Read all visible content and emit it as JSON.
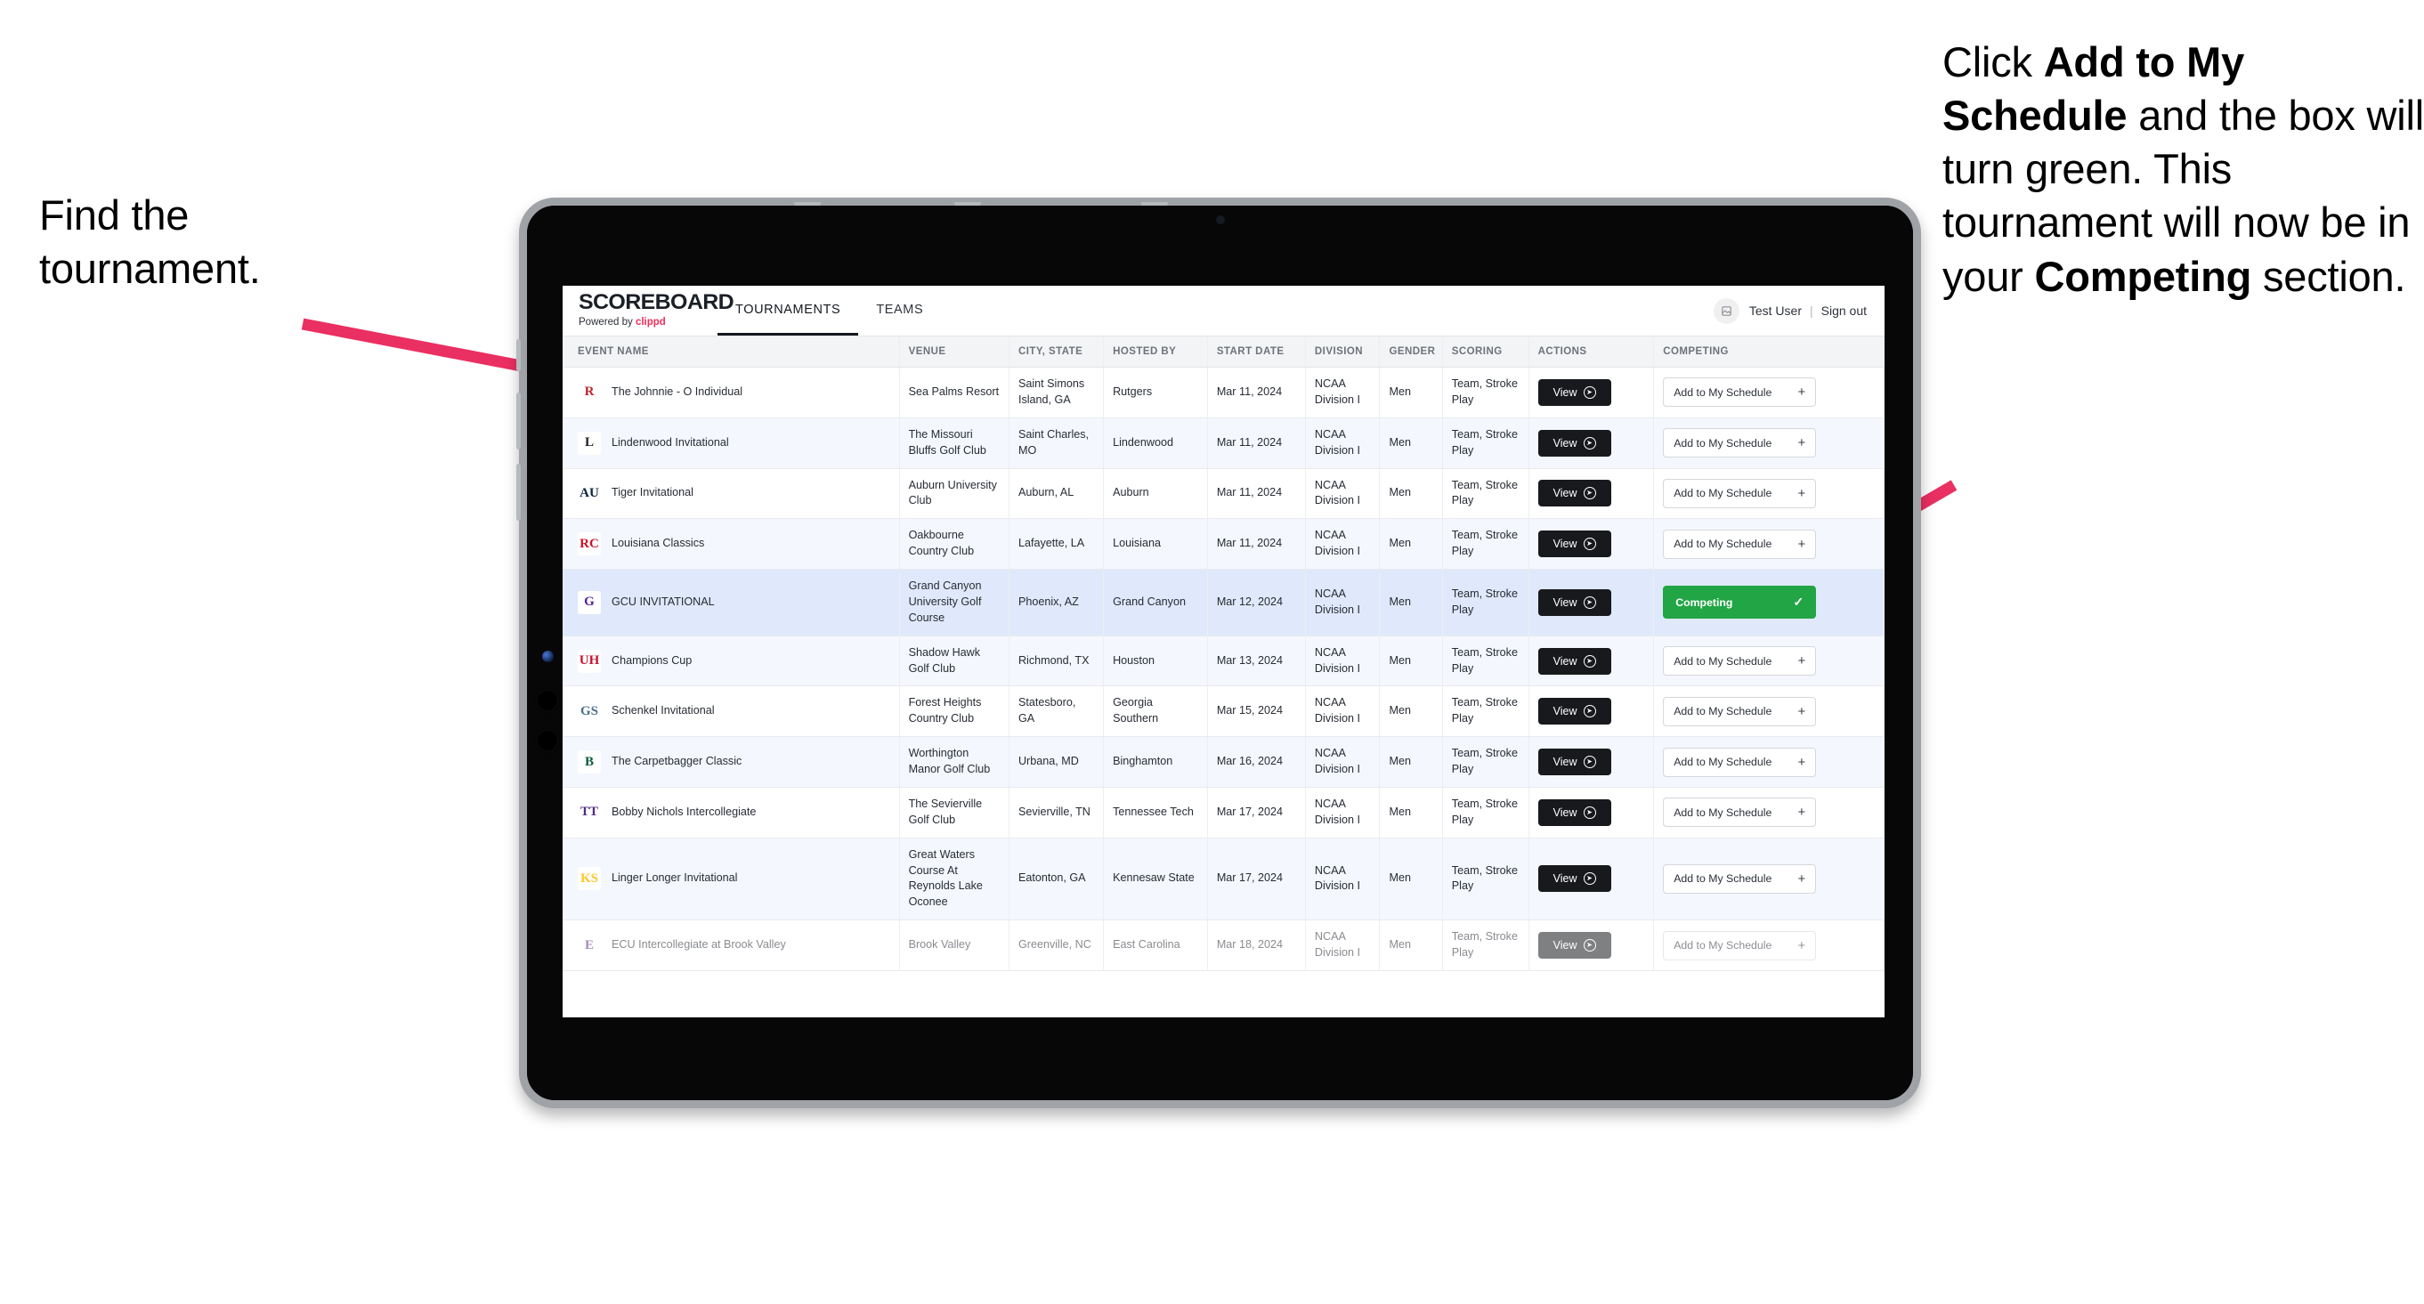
{
  "annotations": {
    "left": "Find the tournament.",
    "right_parts": [
      {
        "t": "Click ",
        "b": false
      },
      {
        "t": "Add to My Schedule",
        "b": true
      },
      {
        "t": " and the box will turn green. This tournament will now be in your ",
        "b": false
      },
      {
        "t": "Competing",
        "b": true
      },
      {
        "t": " section.",
        "b": false
      }
    ],
    "arrow_color": "#ea2f62"
  },
  "app": {
    "brand": {
      "title": "SCOREBOARD",
      "powered_prefix": "Powered by ",
      "powered_brand": "clippd"
    },
    "nav": [
      {
        "label": "TOURNAMENTS",
        "active": true
      },
      {
        "label": "TEAMS",
        "active": false
      }
    ],
    "user": {
      "avatar_icon": "user-avatar-icon",
      "name": "Test User",
      "separator": "|",
      "signout": "Sign out"
    },
    "table": {
      "columns": [
        "EVENT NAME",
        "VENUE",
        "CITY, STATE",
        "HOSTED BY",
        "START DATE",
        "DIVISION",
        "GENDER",
        "SCORING",
        "ACTIONS",
        "COMPETING"
      ],
      "view_label": "View",
      "add_label": "Add to My Schedule",
      "add_icon": "plus-icon",
      "competing_label": "Competing",
      "competing_icon": "check-icon",
      "rows": [
        {
          "logo_text": "R",
          "logo_bg": "#ffffff",
          "logo_fg": "#bb2429",
          "event": "The Johnnie - O Individual",
          "venue": "Sea Palms Resort",
          "city": "Saint Simons Island, GA",
          "hosted": "Rutgers",
          "date": "Mar 11, 2024",
          "division": "NCAA Division I",
          "gender": "Men",
          "scoring": "Team, Stroke Play",
          "competing": false
        },
        {
          "logo_text": "L",
          "logo_bg": "#ffffff",
          "logo_fg": "#1d1d1f",
          "event": "Lindenwood Invitational",
          "venue": "The Missouri Bluffs Golf Club",
          "city": "Saint Charles, MO",
          "hosted": "Lindenwood",
          "date": "Mar 11, 2024",
          "division": "NCAA Division I",
          "gender": "Men",
          "scoring": "Team, Stroke Play",
          "competing": false
        },
        {
          "logo_text": "AU",
          "logo_bg": "#ffffff",
          "logo_fg": "#0c2340",
          "event": "Tiger Invitational",
          "venue": "Auburn University Club",
          "city": "Auburn, AL",
          "hosted": "Auburn",
          "date": "Mar 11, 2024",
          "division": "NCAA Division I",
          "gender": "Men",
          "scoring": "Team, Stroke Play",
          "competing": false
        },
        {
          "logo_text": "RC",
          "logo_bg": "#ffffff",
          "logo_fg": "#ce1126",
          "event": "Louisiana Classics",
          "venue": "Oakbourne Country Club",
          "city": "Lafayette, LA",
          "hosted": "Louisiana",
          "date": "Mar 11, 2024",
          "division": "NCAA Division I",
          "gender": "Men",
          "scoring": "Team, Stroke Play",
          "competing": false
        },
        {
          "logo_text": "G",
          "logo_bg": "#ffffff",
          "logo_fg": "#522398",
          "event": "GCU INVITATIONAL",
          "venue": "Grand Canyon University Golf Course",
          "city": "Phoenix, AZ",
          "hosted": "Grand Canyon",
          "date": "Mar 12, 2024",
          "division": "NCAA Division I",
          "gender": "Men",
          "scoring": "Team, Stroke Play",
          "competing": true
        },
        {
          "logo_text": "UH",
          "logo_bg": "#ffffff",
          "logo_fg": "#c8102e",
          "event": "Champions Cup",
          "venue": "Shadow Hawk Golf Club",
          "city": "Richmond, TX",
          "hosted": "Houston",
          "date": "Mar 13, 2024",
          "division": "NCAA Division I",
          "gender": "Men",
          "scoring": "Team, Stroke Play",
          "competing": false
        },
        {
          "logo_text": "GS",
          "logo_bg": "#ffffff",
          "logo_fg": "#4a6f8a",
          "event": "Schenkel Invitational",
          "venue": "Forest Heights Country Club",
          "city": "Statesboro, GA",
          "hosted": "Georgia Southern",
          "date": "Mar 15, 2024",
          "division": "NCAA Division I",
          "gender": "Men",
          "scoring": "Team, Stroke Play",
          "competing": false
        },
        {
          "logo_text": "B",
          "logo_bg": "#ffffff",
          "logo_fg": "#0b5b3b",
          "event": "The Carpetbagger Classic",
          "venue": "Worthington Manor Golf Club",
          "city": "Urbana, MD",
          "hosted": "Binghamton",
          "date": "Mar 16, 2024",
          "division": "NCAA Division I",
          "gender": "Men",
          "scoring": "Team, Stroke Play",
          "competing": false
        },
        {
          "logo_text": "TT",
          "logo_bg": "#ffffff",
          "logo_fg": "#502d7f",
          "event": "Bobby Nichols Intercollegiate",
          "venue": "The Sevierville Golf Club",
          "city": "Sevierville, TN",
          "hosted": "Tennessee Tech",
          "date": "Mar 17, 2024",
          "division": "NCAA Division I",
          "gender": "Men",
          "scoring": "Team, Stroke Play",
          "competing": false
        },
        {
          "logo_text": "KS",
          "logo_bg": "#ffffff",
          "logo_fg": "#ffc629",
          "event": "Linger Longer Invitational",
          "venue": "Great Waters Course At Reynolds Lake Oconee",
          "city": "Eatonton, GA",
          "hosted": "Kennesaw State",
          "date": "Mar 17, 2024",
          "division": "NCAA Division I",
          "gender": "Men",
          "scoring": "Team, Stroke Play",
          "competing": false
        },
        {
          "logo_text": "E",
          "logo_bg": "#ffffff",
          "logo_fg": "#582c83",
          "event": "ECU Intercollegiate at Brook Valley",
          "venue": "Brook Valley",
          "city": "Greenville, NC",
          "hosted": "East Carolina",
          "date": "Mar 18, 2024",
          "division": "NCAA Division I",
          "gender": "Men",
          "scoring": "Team, Stroke Play",
          "competing": false
        }
      ]
    }
  }
}
